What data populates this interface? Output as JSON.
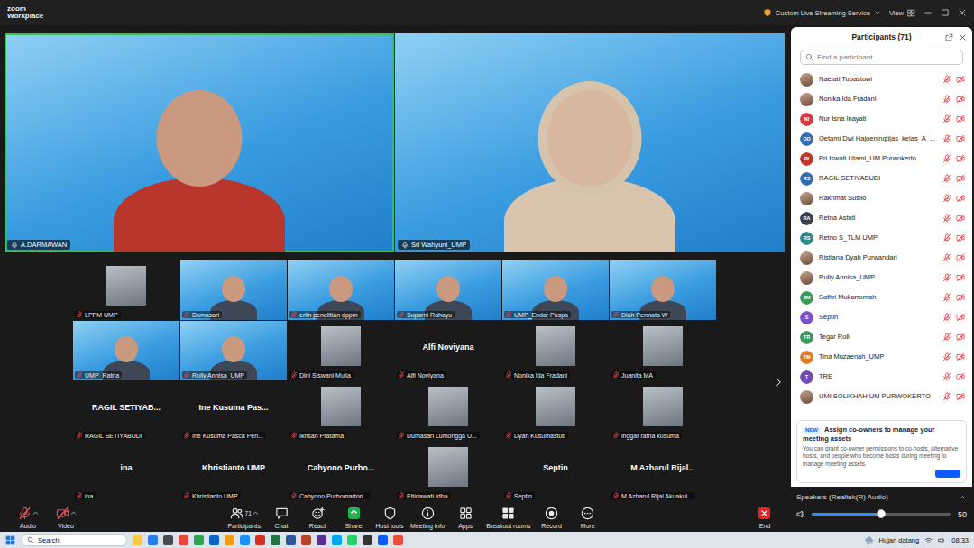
{
  "window": {
    "app": "zoom",
    "product": "Workplace",
    "streaming": "Custom Live Streaming Service",
    "view": "View"
  },
  "speakers": [
    {
      "name": "A.DARMAWAN",
      "active": true,
      "muted": false
    },
    {
      "name": "Sri Wahyuni_UMP",
      "active": false,
      "muted": false
    }
  ],
  "gallery": [
    {
      "label": "LPPM UMP",
      "kind": "picture",
      "muted": true
    },
    {
      "label": "Dumasari",
      "kind": "video",
      "muted": true
    },
    {
      "label": "erlin penelitian dppm",
      "kind": "video",
      "muted": true
    },
    {
      "label": "Suparni Rahayu",
      "kind": "video",
      "muted": true
    },
    {
      "label": "UMP_Endar Puspa",
      "kind": "video",
      "muted": true
    },
    {
      "label": "Diah Permata W",
      "kind": "video",
      "muted": true
    },
    {
      "label": "UMP_Ratna",
      "kind": "video",
      "muted": true
    },
    {
      "label": "Rully Annisa_UMP",
      "kind": "video",
      "muted": true
    },
    {
      "label": "Dini Siswani Mulia",
      "kind": "picture",
      "muted": true
    },
    {
      "label": "Alfi Noviyana",
      "kind": "name",
      "display": "Alfi Noviyana",
      "muted": true
    },
    {
      "label": "Nonika Ida Fradani",
      "kind": "picture",
      "muted": true
    },
    {
      "label": "Juanita MA",
      "kind": "picture",
      "muted": true
    },
    {
      "label": "RAGIL SETIYABUDI",
      "kind": "name",
      "display": "RAGIL SETIYAB...",
      "muted": true
    },
    {
      "label": "Ine Kusuma Pasca Pen...",
      "kind": "name",
      "display": "Ine Kusuma Pas...",
      "muted": true
    },
    {
      "label": "Ikhsan Pratama",
      "kind": "picture",
      "muted": true
    },
    {
      "label": "Dumasari Lumongga U...",
      "kind": "picture",
      "muted": true
    },
    {
      "label": "Dyah Kusumastuti",
      "kind": "picture",
      "muted": true
    },
    {
      "label": "inggar ratna kusuma",
      "kind": "picture",
      "muted": true
    },
    {
      "label": "ina",
      "kind": "name",
      "display": "ina",
      "muted": true
    },
    {
      "label": "Khristianto UMP",
      "kind": "name",
      "display": "Khristianto UMP",
      "muted": true
    },
    {
      "label": "Cahyono Purbomarton...",
      "kind": "name",
      "display": "Cahyono Purbo...",
      "muted": true
    },
    {
      "label": "Etiidawati Idha",
      "kind": "picture",
      "muted": true
    },
    {
      "label": "Septin",
      "kind": "name",
      "display": "Septin",
      "muted": true
    },
    {
      "label": "M Azharul Rijal Akuakul...",
      "kind": "name",
      "display": "M Azharul Rijal...",
      "muted": true
    }
  ],
  "toolbar": [
    {
      "label": "Audio",
      "kind": "audio",
      "off": true
    },
    {
      "label": "Video",
      "kind": "video",
      "off": true
    },
    {
      "label": "Participants",
      "kind": "participants",
      "off": false,
      "badge": "71"
    },
    {
      "label": "Chat",
      "kind": "chat",
      "off": false
    },
    {
      "label": "React",
      "kind": "react",
      "off": false
    },
    {
      "label": "Share",
      "kind": "share",
      "off": false
    },
    {
      "label": "Host tools",
      "kind": "host",
      "off": false
    },
    {
      "label": "Meeting info",
      "kind": "info",
      "off": false
    },
    {
      "label": "Apps",
      "kind": "apps",
      "off": false
    },
    {
      "label": "Breakout rooms",
      "kind": "breakout",
      "off": false
    },
    {
      "label": "Record",
      "kind": "record",
      "off": false
    },
    {
      "label": "More",
      "kind": "more",
      "off": false
    },
    {
      "label": "End",
      "kind": "end",
      "off": false
    }
  ],
  "participants": {
    "title": "Participants (71)",
    "search": {
      "placeholder": "Find a participant"
    },
    "items": [
      {
        "name": "Naelati Tubastuwi",
        "kind": "photo",
        "muted": true,
        "video_off": true
      },
      {
        "name": "Nonika Ida Fradani",
        "kind": "photo",
        "muted": true,
        "video_off": true
      },
      {
        "name": "Nur Isna Inayati",
        "kind": "initials",
        "initials": "NI",
        "color": "#d9363e",
        "muted": true,
        "video_off": true
      },
      {
        "name": "Oetami Dwi Hajoeningtijas_kelas_A_...",
        "kind": "initials",
        "initials": "OD",
        "color": "#2d6db5",
        "muted": true,
        "video_off": true
      },
      {
        "name": "Pri Iswati Utami_UM Purwokerto",
        "kind": "initials",
        "initials": "PI",
        "color": "#c0392b",
        "muted": true,
        "video_off": true
      },
      {
        "name": "RAGIL SETIYABUDI",
        "kind": "initials",
        "initials": "RS",
        "color": "#2f6fb0",
        "muted": true,
        "video_off": true
      },
      {
        "name": "Rakhmat Susilo",
        "kind": "photo",
        "muted": true,
        "video_off": true
      },
      {
        "name": "Retna Astuti",
        "kind": "initials",
        "initials": "RA",
        "color": "#3b3f4c",
        "muted": true,
        "video_off": true
      },
      {
        "name": "Retno S_TLM UMP",
        "kind": "initials",
        "initials": "RS",
        "color": "#2e8b8b",
        "muted": true,
        "video_off": true
      },
      {
        "name": "Ristiana Dyah Purwandari",
        "kind": "photo",
        "muted": true,
        "video_off": true
      },
      {
        "name": "Rully Annisa_UMP",
        "kind": "photo",
        "muted": true,
        "video_off": true
      },
      {
        "name": "Safitri Mukarromah",
        "kind": "initials",
        "initials": "SM",
        "color": "#3a9a5a",
        "muted": true,
        "video_off": true
      },
      {
        "name": "Septin",
        "kind": "initials",
        "initials": "S",
        "color": "#7b4fc9",
        "muted": true,
        "video_off": true
      },
      {
        "name": "Tegar Roli",
        "kind": "initials",
        "initials": "TR",
        "color": "#3a9a5a",
        "muted": true,
        "video_off": true
      },
      {
        "name": "Tina Muzaenah_UMP",
        "kind": "initials",
        "initials": "TM",
        "color": "#e07a1f",
        "muted": true,
        "video_off": true
      },
      {
        "name": "TRE",
        "kind": "initials",
        "initials": "T",
        "color": "#6f4bb8",
        "muted": true,
        "video_off": true
      },
      {
        "name": "UMI SOLIKHAH UM PURWOKERTO",
        "kind": "photo",
        "muted": true,
        "video_off": true
      }
    ]
  },
  "notice": {
    "badge": "NEW",
    "title": "Assign co-owners to manage your meeting assets",
    "body": "You can grant co-owner permissions to co-hosts, alternative hosts, and people who become hosts during meeting to manage meeting assets."
  },
  "audio_output": {
    "label": "Speakers (Realtek(R) Audio)",
    "level": 0.5,
    "reading": "50"
  },
  "taskbar": {
    "search": "Search",
    "weather": "Hujan datang",
    "time": "08.33"
  }
}
